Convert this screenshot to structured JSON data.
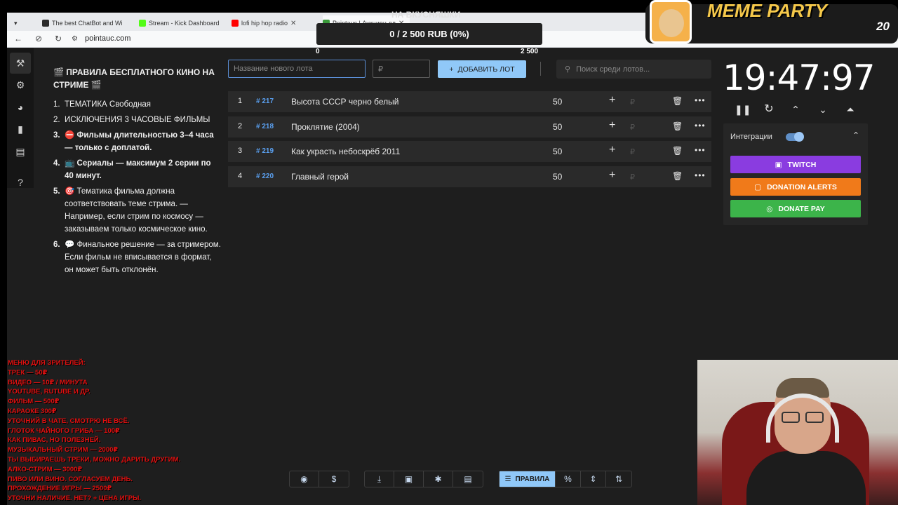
{
  "browser": {
    "tabs": [
      {
        "label": "The best ChatBot and Wi",
        "color": "#2b2b2b"
      },
      {
        "label": "Stream - Kick Dashboard",
        "color": "#53fc18"
      },
      {
        "label": "lofi hip hop radio",
        "color": "#ff0000"
      },
      {
        "label": "Pointauc | Аукцион дл",
        "color": "#3a9a3a"
      }
    ],
    "url": "pointauc.com"
  },
  "overlay": {
    "goal_title": "НА ВКУСНЯШКИ",
    "goal_progress_text": "0 / 2 500 RUB (0%)",
    "goal_progress": 0,
    "goal_min": "0",
    "goal_max": "2 500",
    "meme_title": "MEME PARTY",
    "meme_count": "20"
  },
  "rules": {
    "title": "🎬 ПРАВИЛА БЕСПЛАТНОГО КИНО НА СТРИМЕ 🎬",
    "items": [
      {
        "n": "1.",
        "text": "ТЕМАТИКА Свободная"
      },
      {
        "n": "2.",
        "text": "ИСКЛЮЧЕНИЯ  3 ЧАСОВЫЕ ФИЛЬМЫ"
      },
      {
        "n": "3.",
        "text": "⛔ Фильмы длительностью 3–4 часа — только с доплатой."
      },
      {
        "n": "4.",
        "text": "📺 Сериалы — максимум 2 серии по 40 минут."
      },
      {
        "n": "5.",
        "text": "🎯 Тематика фильма должна соответствовать теме стрима. — Например, если стрим по космосу — заказываем только космическое кино."
      },
      {
        "n": "6.",
        "text": "💬 Финальное решение — за стримером. Если фильм не вписывается в формат, он может быть отклонён."
      }
    ]
  },
  "form": {
    "lot_name_placeholder": "Название нового лота",
    "amount_placeholder": "₽",
    "add_label": "ДОБАВИТЬ ЛОТ",
    "search_placeholder": "Поиск среди лотов..."
  },
  "lots": [
    {
      "num": "1",
      "id": "# 217",
      "name": "Высота СССР черно белый",
      "amount": "50",
      "currency": "₽"
    },
    {
      "num": "2",
      "id": "# 218",
      "name": "Проклятие (2004)",
      "amount": "50",
      "currency": "₽"
    },
    {
      "num": "3",
      "id": "# 219",
      "name": "Как украсть небоскрёб 2011",
      "amount": "50",
      "currency": "₽"
    },
    {
      "num": "4",
      "id": "# 220",
      "name": "Главный герой",
      "amount": "50",
      "currency": "₽"
    }
  ],
  "timer": {
    "value": "19:47:97"
  },
  "integrations": {
    "label": "Интеграции",
    "enabled": true,
    "buttons": [
      {
        "label": "TWITCH",
        "color": "#8a3ce0"
      },
      {
        "label": "DONATION ALERTS",
        "color": "#f07a1a"
      },
      {
        "label": "DONATE PAY",
        "color": "#3cb44a"
      }
    ]
  },
  "toolbar": {
    "rules_label": "ПРАВИЛА"
  },
  "viewer_menu": [
    "МЕНЮ ДЛЯ ЗРИТЕЛЕЙ:",
    " ТРЕК — 50₽",
    "ВИДЕО — 10₽ / МИНУТА",
    "YOUTUBE, RUTUBE И ДР.",
    " ФИЛЬМ — 500₽",
    "КАРАОКЕ 300₽",
    "УТОЧНИЙ В ЧАТЕ, СМОТРЮ НЕ ВСЁ.",
    " ГЛОТОК ЧАЙНОГО ГРИБА — 100₽",
    "КАК ПИВАС, НО ПОЛЕЗНЕЙ.",
    "МУЗЫКАЛЬНЫЙ СТРИМ — 2000₽",
    "ТЫ ВЫБИРАЕШЬ ТРЕКИ, МОЖНО ДАРИТЬ ДРУГИМ.",
    " АЛКО-СТРИМ — 3000₽",
    "ПИВО ИЛИ ВИНО. СОГЛАСУЕМ ДЕНЬ.",
    " ПРОХОЖДЕНИЕ ИГРЫ — 2500₽",
    "УТОЧНИ НАЛИЧИЕ. НЕТ? + ЦЕНА ИГРЫ."
  ]
}
